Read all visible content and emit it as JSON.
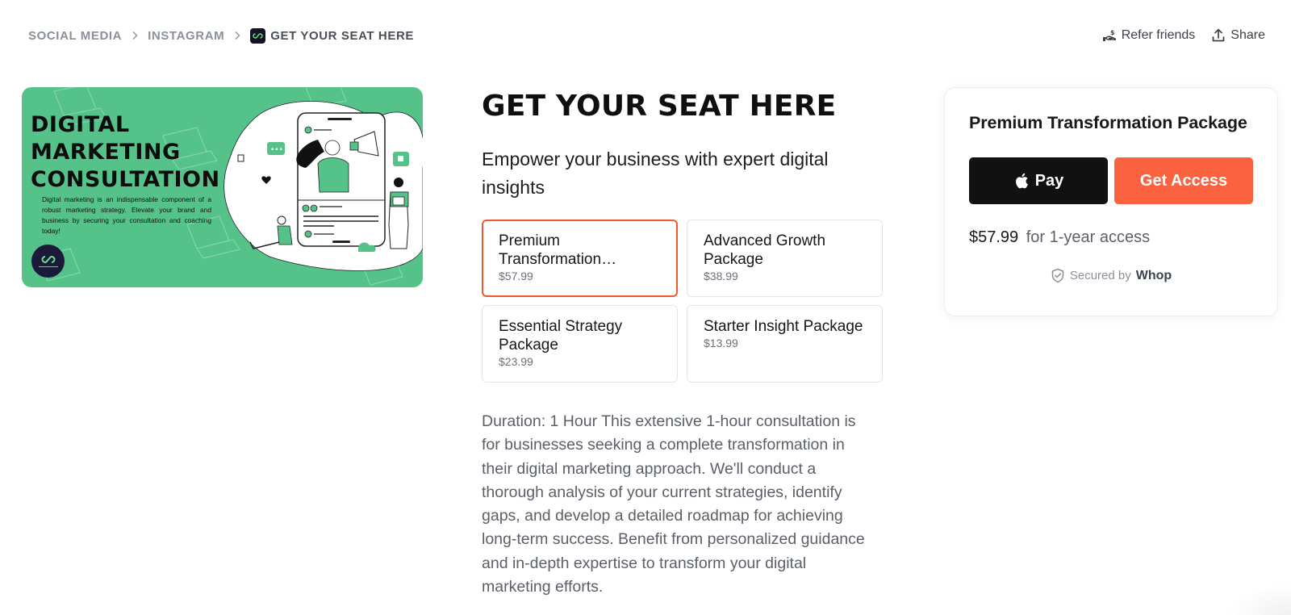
{
  "breadcrumb": {
    "items": [
      {
        "label": "SOCIAL MEDIA"
      },
      {
        "label": "INSTAGRAM"
      },
      {
        "label": "GET YOUR SEAT HERE",
        "icon": "product-logo-icon"
      }
    ],
    "separator_icon": "chevron-right-icon"
  },
  "top_actions": {
    "refer": {
      "label": "Refer friends",
      "icon": "hand-dollar-icon"
    },
    "share": {
      "label": "Share",
      "icon": "share-upload-icon"
    }
  },
  "hero_image": {
    "title_lines": [
      "DIGITAL",
      "MARKETING",
      "CONSULTATION"
    ],
    "text": "Digital marketing is an indispensable component of a robust marketing strategy. Elevate your brand and business by securing your consultation and coaching today!",
    "colors": {
      "background": "#55c28a",
      "text": "#0d0d0d"
    }
  },
  "product": {
    "title": "GET YOUR SEAT HERE",
    "subtitle": "Empower your business with expert digital insights",
    "plans": [
      {
        "name": "Premium Transformation Package",
        "price": "$57.99",
        "selected": true
      },
      {
        "name": "Advanced Growth Package",
        "price": "$38.99",
        "selected": false
      },
      {
        "name": "Essential Strategy Package",
        "price": "$23.99",
        "selected": false
      },
      {
        "name": "Starter Insight Package",
        "price": "$13.99",
        "selected": false
      }
    ],
    "description": "Duration: 1 Hour This extensive 1-hour consultation is for businesses seeking a complete transformation in their digital marketing approach. We'll conduct a thorough analysis of your current strategies, identify gaps, and develop a detailed roadmap for achieving long-term success. Benefit from personalized guidance and in-depth expertise to transform your digital marketing efforts."
  },
  "checkout": {
    "plan_title": "Premium Transformation Package",
    "apple_pay_label": "Pay",
    "get_access_label": "Get Access",
    "price": "$57.99",
    "price_suffix": "for 1-year access",
    "secured_label": "Secured by",
    "secured_brand": "Whop"
  },
  "colors": {
    "accent": "#fb6240",
    "selected_border": "#f2562c",
    "apple_pay_bg": "#111111"
  }
}
